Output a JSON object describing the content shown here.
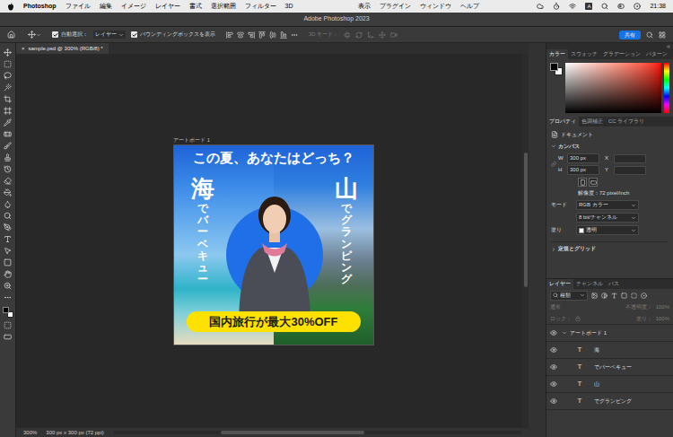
{
  "menu_bar": {
    "app": "Photoshop",
    "menus_left": [
      "ファイル",
      "編集",
      "イメージ",
      "レイヤー",
      "書式",
      "選択範囲",
      "フィルター",
      "3D"
    ],
    "menus_right": [
      "表示",
      "プラグイン",
      "ウィンドウ",
      "ヘルプ"
    ],
    "input_method": "A",
    "clock": "21:38"
  },
  "window": {
    "title": "Adobe Photoshop 2023"
  },
  "options_bar": {
    "auto_select": {
      "label": "自動選択：",
      "checked": true
    },
    "auto_select_target": "レイヤー",
    "bounding_box": {
      "label": "バウンディングボックスを表示",
      "checked": true
    },
    "mode_3d": {
      "label": "3D モード：",
      "disabled": true
    },
    "share_button": "共有"
  },
  "document_tabs": [
    {
      "title": "sample.psd @ 300% (RGB/8) *",
      "close": "×",
      "selected": true
    }
  ],
  "artboard": {
    "label": "アートボード 1",
    "headline": "この夏、あなたはどっち？",
    "left": {
      "title": "海",
      "subtitle": "でバーベキュー"
    },
    "right": {
      "title": "山",
      "subtitle": "でグランピング"
    },
    "offer": "国内旅行が最大30%OFF"
  },
  "status_bar": {
    "zoom": "300%",
    "document_size": "300 px x 300 px (72 ppi)"
  },
  "color_panel": {
    "tabs": [
      {
        "label": "カラー",
        "selected": true
      },
      {
        "label": "スウォッチ",
        "selected": false
      },
      {
        "label": "グラデーション",
        "selected": false
      },
      {
        "label": "パターン",
        "selected": false
      }
    ]
  },
  "properties_panel": {
    "tabs": [
      {
        "label": "プロパティ",
        "selected": true
      },
      {
        "label": "色調補正",
        "selected": false
      },
      {
        "label": "CC ライブラリ",
        "selected": false
      }
    ],
    "context": "ドキュメント",
    "canvas": {
      "label": "カンバス",
      "expanded": true,
      "fields": [
        {
          "label": "W",
          "value": "300 px",
          "offset_label": "X"
        },
        {
          "label": "H",
          "value": "300 px",
          "offset_label": "Y"
        }
      ],
      "resolution": "解像度：72 pixel/inch",
      "mode": {
        "label": "モード",
        "value": "RGB カラー"
      },
      "depth": "8 bit/チャンネル",
      "fill": {
        "label": "塗り",
        "value": "透明"
      }
    },
    "rulers": {
      "label": "定規とグリッド",
      "expanded": false
    }
  },
  "layers_panel": {
    "tabs": [
      {
        "label": "レイヤー",
        "selected": true
      },
      {
        "label": "チャンネル",
        "selected": false
      },
      {
        "label": "パス",
        "selected": false
      }
    ],
    "filter": "種類",
    "blend_mode": {
      "value": "通常",
      "disabled": true
    },
    "opacity": {
      "label": "不透明度：",
      "value": "100%",
      "disabled": true
    },
    "lock": {
      "label": "ロック：",
      "disabled": true
    },
    "fill": {
      "label": "塗り：",
      "value": "100%",
      "disabled": true
    },
    "layers": [
      {
        "name": "アートボード 1",
        "kind": "artboard",
        "visible": true,
        "expanded": true,
        "selected": false
      },
      {
        "name": "海",
        "kind": "text",
        "icon": "T",
        "visible": true,
        "selected": false
      },
      {
        "name": "でバーベキュー",
        "kind": "text",
        "icon": "T",
        "visible": true,
        "selected": false
      },
      {
        "name": "山",
        "kind": "text",
        "icon": "T",
        "visible": true,
        "selected": false
      },
      {
        "name": "でグランピング",
        "kind": "text",
        "icon": "T",
        "visible": true,
        "selected": false
      }
    ]
  }
}
